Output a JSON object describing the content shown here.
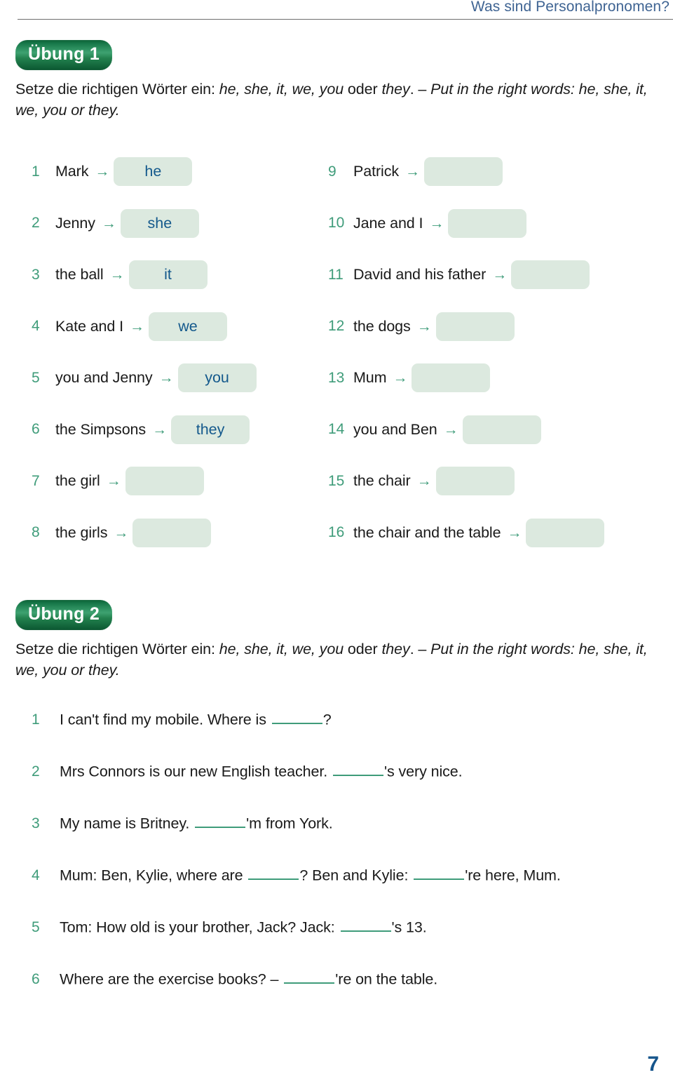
{
  "header": {
    "title": "Was sind Personalpronomen?"
  },
  "page_number": "7",
  "icons": {
    "arrow": "→"
  },
  "exercise1": {
    "badge": "Übung 1",
    "instruction": {
      "part1": "Setze die richtigen Wörter ein: ",
      "pronouns_de": "he, she, it, we, you",
      "part2": " oder ",
      "they_de": "they",
      "part3": ". – ",
      "english": "Put in the right words: he, she, it, we, you or they."
    },
    "left_items": [
      {
        "num": "1",
        "cue": "Mark",
        "answer": "he"
      },
      {
        "num": "2",
        "cue": "Jenny",
        "answer": "she"
      },
      {
        "num": "3",
        "cue": "the ball",
        "answer": "it"
      },
      {
        "num": "4",
        "cue": "Kate and I",
        "answer": "we"
      },
      {
        "num": "5",
        "cue": "you and Jenny",
        "answer": "you"
      },
      {
        "num": "6",
        "cue": "the Simpsons",
        "answer": "they"
      },
      {
        "num": "7",
        "cue": "the girl",
        "answer": ""
      },
      {
        "num": "8",
        "cue": "the girls",
        "answer": ""
      }
    ],
    "right_items": [
      {
        "num": "9",
        "cue": "Patrick",
        "answer": ""
      },
      {
        "num": "10",
        "cue": "Jane and I",
        "answer": ""
      },
      {
        "num": "11",
        "cue": "David and his father",
        "answer": ""
      },
      {
        "num": "12",
        "cue": "the dogs",
        "answer": ""
      },
      {
        "num": "13",
        "cue": "Mum",
        "answer": ""
      },
      {
        "num": "14",
        "cue": "you and Ben",
        "answer": ""
      },
      {
        "num": "15",
        "cue": "the chair",
        "answer": ""
      },
      {
        "num": "16",
        "cue": "the chair and the table",
        "answer": ""
      }
    ]
  },
  "exercise2": {
    "badge": "Übung 2",
    "instruction": {
      "part1": "Setze die richtigen Wörter ein: ",
      "pronouns_de": "he, she, it, we, you",
      "part2": " oder ",
      "they_de": "they",
      "part3": ". – ",
      "english": "Put in the right words: he, she, it, we, you or they."
    },
    "items": [
      {
        "num": "1",
        "segments": [
          "I can't find my mobile. Where is ",
          "?"
        ]
      },
      {
        "num": "2",
        "segments": [
          "Mrs Connors is our new English teacher. ",
          "'s very nice."
        ]
      },
      {
        "num": "3",
        "segments": [
          "My name is Britney. ",
          "'m from York."
        ]
      },
      {
        "num": "4",
        "segments": [
          "Mum: Ben, Kylie, where are ",
          "? Ben and Kylie: ",
          "'re here, Mum."
        ]
      },
      {
        "num": "5",
        "segments": [
          "Tom: How old is your brother, Jack? Jack: ",
          "'s 13."
        ]
      },
      {
        "num": "6",
        "segments": [
          "Where are the exercise books? – ",
          "'re on the table."
        ]
      }
    ]
  }
}
